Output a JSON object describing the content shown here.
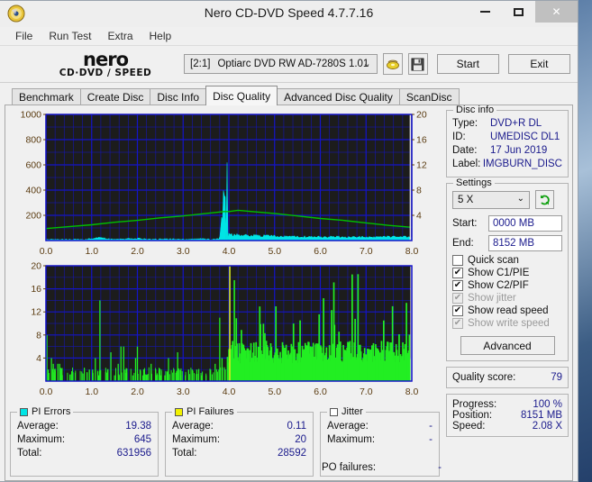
{
  "window": {
    "title": "Nero CD-DVD Speed 4.7.7.16",
    "app_icon": "nero-disc-icon",
    "minimize": "—",
    "maximize": "☐",
    "close": "✕"
  },
  "menu": {
    "items": [
      {
        "label": "File"
      },
      {
        "label": "Run Test"
      },
      {
        "label": "Extra"
      },
      {
        "label": "Help"
      }
    ]
  },
  "toolbar": {
    "logo_word": "nero",
    "logo_sub": "CD·DVD ∕ SPEED",
    "drive_index": "[2:1]",
    "drive_name": "Optiarc DVD RW AD-7280S 1.01",
    "dropdown_caret": "⌄",
    "eject_icon": "eject-disc-icon",
    "save_icon": "floppy-save-icon",
    "start_label": "Start",
    "exit_label": "Exit"
  },
  "tabs": [
    {
      "label": "Benchmark",
      "active": false
    },
    {
      "label": "Create Disc",
      "active": false
    },
    {
      "label": "Disc Info",
      "active": false
    },
    {
      "label": "Disc Quality",
      "active": true
    },
    {
      "label": "Advanced Disc Quality",
      "active": false
    },
    {
      "label": "ScanDisc",
      "active": false
    }
  ],
  "disc_info": {
    "title": "Disc info",
    "type_label": "Type:",
    "type_value": "DVD+R DL",
    "id_label": "ID:",
    "id_value": "UMEDISC DL1",
    "date_label": "Date:",
    "date_value": "17 Jun 2019",
    "label_label": "Label:",
    "label_value": "IMGBURN_DISC"
  },
  "settings": {
    "title": "Settings",
    "speed_value": "5 X",
    "speed_caret": "⌄",
    "refresh_icon": "refresh-icon",
    "start_label": "Start:",
    "start_value": "0000 MB",
    "end_label": "End:",
    "end_value": "8152 MB",
    "checkboxes": [
      {
        "label": "Quick scan",
        "checked": false,
        "enabled": true
      },
      {
        "label": "Show C1/PIE",
        "checked": true,
        "enabled": true
      },
      {
        "label": "Show C2/PIF",
        "checked": true,
        "enabled": true
      },
      {
        "label": "Show jitter",
        "checked": true,
        "enabled": false
      },
      {
        "label": "Show read speed",
        "checked": true,
        "enabled": true
      },
      {
        "label": "Show write speed",
        "checked": true,
        "enabled": false
      }
    ],
    "check_glyph": "✔",
    "advanced_label": "Advanced"
  },
  "quality": {
    "label": "Quality score:",
    "value": "79"
  },
  "progress": {
    "progress_label": "Progress:",
    "progress_value": "100 %",
    "position_label": "Position:",
    "position_value": "8151 MB",
    "speed_label": "Speed:",
    "speed_value": "2.08 X"
  },
  "stats": {
    "pi_errors": {
      "title": "PI Errors",
      "color": "#00e5e5",
      "rows": [
        {
          "k": "Average:",
          "v": "19.38"
        },
        {
          "k": "Maximum:",
          "v": "645"
        },
        {
          "k": "Total:",
          "v": "631956"
        }
      ]
    },
    "pi_failures": {
      "title": "PI Failures",
      "color": "#f2f200",
      "rows": [
        {
          "k": "Average:",
          "v": "0.11"
        },
        {
          "k": "Maximum:",
          "v": "20"
        },
        {
          "k": "Total:",
          "v": "28592"
        }
      ]
    },
    "jitter": {
      "title": "Jitter",
      "color": "#ffffff",
      "rows": [
        {
          "k": "Average:",
          "v": "-"
        },
        {
          "k": "Maximum:",
          "v": "-"
        }
      ],
      "po_label": "PO failures:",
      "po_value": "-"
    }
  },
  "chart_data": [
    {
      "type": "line",
      "name": "pi-errors-chart",
      "title": "",
      "xlabel": "",
      "ylabel": "",
      "xlim": [
        0.0,
        8.0
      ],
      "xticks": [
        "0.0",
        "1.0",
        "2.0",
        "3.0",
        "4.0",
        "5.0",
        "6.0",
        "7.0",
        "8.0"
      ],
      "ylim": [
        0,
        1000
      ],
      "yticks": [
        "200",
        "400",
        "600",
        "800",
        "1000"
      ],
      "y2lim": [
        0,
        20
      ],
      "y2ticks": [
        "4",
        "8",
        "12",
        "16",
        "20"
      ],
      "grid": true,
      "background": "#1c1c1c",
      "gridcolor": "#1414c8",
      "series": [
        {
          "name": "PI Errors",
          "color": "#00e5e5",
          "axis": "left",
          "style": "area",
          "x": [
            0.0,
            0.2,
            0.4,
            0.6,
            0.8,
            1.0,
            1.2,
            1.4,
            1.6,
            1.8,
            2.0,
            2.2,
            2.4,
            2.6,
            2.8,
            3.0,
            3.2,
            3.4,
            3.6,
            3.8,
            3.95,
            4.0,
            4.1,
            4.3,
            4.5,
            4.7,
            4.9,
            5.1,
            5.3,
            5.5,
            5.7,
            5.9,
            6.1,
            6.3,
            6.5,
            6.7,
            6.9,
            7.1,
            7.3,
            7.5,
            7.7,
            7.9,
            8.0
          ],
          "y": [
            8,
            10,
            9,
            11,
            9,
            12,
            22,
            10,
            9,
            14,
            18,
            10,
            9,
            12,
            11,
            9,
            10,
            13,
            9,
            12,
            620,
            55,
            40,
            44,
            38,
            36,
            34,
            32,
            30,
            31,
            29,
            28,
            27,
            29,
            26,
            25,
            27,
            24,
            26,
            30,
            32,
            28,
            26
          ]
        },
        {
          "name": "Read speed",
          "color": "#00c000",
          "axis": "right",
          "style": "line",
          "x": [
            0.0,
            0.5,
            1.0,
            1.5,
            2.0,
            2.5,
            3.0,
            3.5,
            3.9,
            4.0,
            4.2,
            4.5,
            5.0,
            5.5,
            6.0,
            6.5,
            7.0,
            7.5,
            8.0
          ],
          "y": [
            1.9,
            2.2,
            2.5,
            2.9,
            3.2,
            3.6,
            3.9,
            4.3,
            4.6,
            4.6,
            4.8,
            4.6,
            4.3,
            3.9,
            3.5,
            3.2,
            2.8,
            2.4,
            2.1
          ]
        }
      ]
    },
    {
      "type": "bar",
      "name": "pi-failures-chart",
      "title": "",
      "xlabel": "",
      "ylabel": "",
      "xlim": [
        0.0,
        8.0
      ],
      "xticks": [
        "0.0",
        "1.0",
        "2.0",
        "3.0",
        "4.0",
        "5.0",
        "6.0",
        "7.0",
        "8.0"
      ],
      "ylim": [
        0,
        20
      ],
      "yticks": [
        "4",
        "8",
        "12",
        "16",
        "20"
      ],
      "grid": true,
      "background": "#1c1c1c",
      "gridcolor": "#1414c8",
      "series": [
        {
          "name": "PI Failures",
          "color": "#22ee22",
          "style": "spikes",
          "note": "layer 0 (0-4 GB) sparse spikes; layer 1 (4-8 GB) dense high-amplitude spikes",
          "layer0_x": [
            0.02,
            0.05,
            0.12,
            0.16,
            0.2,
            0.26,
            0.3,
            0.34,
            0.95,
            1.02,
            1.08,
            1.15,
            1.18,
            1.35,
            1.42,
            1.5,
            1.58,
            1.64,
            1.7,
            1.76,
            1.9,
            1.96,
            2.0,
            2.06,
            2.12,
            2.2,
            2.3,
            2.4,
            2.5,
            2.6,
            2.68,
            2.8,
            2.88,
            2.95,
            3.05,
            3.12,
            3.2,
            3.3,
            3.4,
            3.5,
            3.6,
            3.7,
            3.8,
            3.85,
            3.92
          ],
          "layer0_y": [
            8,
            2,
            4,
            3,
            1,
            3,
            3,
            1,
            2,
            2,
            4,
            1,
            14,
            2,
            5,
            1,
            3,
            6,
            6,
            2,
            1,
            4,
            6,
            2,
            1,
            1,
            3,
            2,
            1,
            1,
            4,
            2,
            5,
            1,
            1,
            2,
            2,
            2,
            1,
            1,
            2,
            3,
            11,
            4,
            2
          ],
          "layer1_density": "dense",
          "layer1_typical": 5,
          "layer1_max": 20
        }
      ]
    }
  ]
}
